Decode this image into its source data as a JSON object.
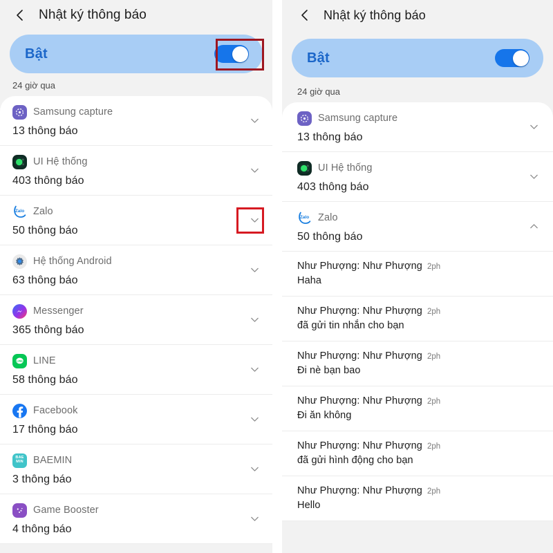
{
  "left": {
    "header": {
      "back_icon": "chevron-left-icon",
      "title": "Nhật ký thông báo"
    },
    "master_switch": {
      "label": "Bật",
      "state": "on"
    },
    "section_label": "24 giờ qua",
    "apps": [
      {
        "icon": "samsung-capture-icon",
        "name": "Samsung capture",
        "count": "13 thông báo",
        "chevron": "chevron-down-icon"
      },
      {
        "icon": "ui-system-icon",
        "name": "UI Hệ thống",
        "count": "403 thông báo",
        "chevron": "chevron-down-icon"
      },
      {
        "icon": "zalo-icon",
        "name": "Zalo",
        "count": "50 thông báo",
        "chevron": "chevron-down-icon"
      },
      {
        "icon": "android-system-icon",
        "name": "Hệ thống Android",
        "count": "63 thông báo",
        "chevron": "chevron-down-icon"
      },
      {
        "icon": "messenger-icon",
        "name": "Messenger",
        "count": "365 thông báo",
        "chevron": "chevron-down-icon"
      },
      {
        "icon": "line-icon",
        "name": "LINE",
        "count": "58 thông báo",
        "chevron": "chevron-down-icon"
      },
      {
        "icon": "facebook-icon",
        "name": "Facebook",
        "count": "17 thông báo",
        "chevron": "chevron-down-icon"
      },
      {
        "icon": "baemin-icon",
        "name": "BAEMIN",
        "count": "3 thông báo",
        "chevron": "chevron-down-icon"
      },
      {
        "icon": "game-booster-icon",
        "name": "Game Booster",
        "count": "4 thông báo",
        "chevron": "chevron-down-icon"
      }
    ]
  },
  "right": {
    "header": {
      "back_icon": "chevron-left-icon",
      "title": "Nhật ký thông báo"
    },
    "master_switch": {
      "label": "Bật",
      "state": "on"
    },
    "section_label": "24 giờ qua",
    "apps": [
      {
        "icon": "samsung-capture-icon",
        "name": "Samsung capture",
        "count": "13 thông báo",
        "chevron": "chevron-down-icon"
      },
      {
        "icon": "ui-system-icon",
        "name": "UI Hệ thống",
        "count": "403 thông báo",
        "chevron": "chevron-down-icon"
      },
      {
        "icon": "zalo-icon",
        "name": "Zalo",
        "count": "50 thông báo",
        "chevron": "chevron-up-icon"
      }
    ],
    "notifications": [
      {
        "title": "Như Phượng: Như Phượng",
        "time": "2ph",
        "body": "Haha"
      },
      {
        "title": "Như Phượng: Như Phượng",
        "time": "2ph",
        "body": "đã gửi tin nhắn cho bạn"
      },
      {
        "title": "Như Phượng: Như Phượng",
        "time": "2ph",
        "body": "Đi nè bạn bao"
      },
      {
        "title": "Như Phượng: Như Phượng",
        "time": "2ph",
        "body": "Đi ăn không"
      },
      {
        "title": "Như Phượng: Như Phượng",
        "time": "2ph",
        "body": "đã gửi hình động cho bạn"
      },
      {
        "title": "Như Phượng: Như Phượng",
        "time": "2ph",
        "body": "Hello"
      }
    ]
  },
  "annotations": {
    "toggle_highlight": "highlight-box-toggle",
    "chevron_highlight": "highlight-box-zalo-chevron"
  },
  "colors": {
    "switch_card_bg": "#a8cdf5",
    "switch_label": "#1b66c9",
    "toggle_on": "#1675ea",
    "panel_bg": "#f2f2f2",
    "highlight_dark_red": "#9e1620",
    "highlight_red": "#d61a22"
  }
}
